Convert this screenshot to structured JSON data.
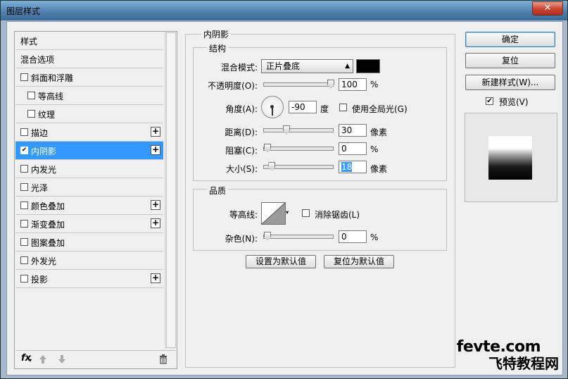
{
  "window": {
    "title": "图层样式",
    "close_glyph": "✕"
  },
  "styles_list": {
    "header": "样式",
    "blend_options": "混合选项",
    "items": [
      {
        "label": "斜面和浮雕",
        "checked": false,
        "has_plus": false
      },
      {
        "label": "等高线",
        "checked": false,
        "has_plus": false,
        "indent": true
      },
      {
        "label": "纹理",
        "checked": false,
        "has_plus": false,
        "indent": true
      },
      {
        "label": "描边",
        "checked": false,
        "has_plus": true
      },
      {
        "label": "内阴影",
        "checked": true,
        "has_plus": true,
        "selected": true
      },
      {
        "label": "内发光",
        "checked": false,
        "has_plus": false
      },
      {
        "label": "光泽",
        "checked": false,
        "has_plus": false
      },
      {
        "label": "颜色叠加",
        "checked": false,
        "has_plus": true
      },
      {
        "label": "渐变叠加",
        "checked": false,
        "has_plus": true
      },
      {
        "label": "图案叠加",
        "checked": false,
        "has_plus": false
      },
      {
        "label": "外发光",
        "checked": false,
        "has_plus": false
      },
      {
        "label": "投影",
        "checked": false,
        "has_plus": true
      }
    ],
    "footer": {
      "fx": "fx",
      "up_icon": "arrow-up-icon",
      "down_icon": "arrow-down-icon",
      "trash_icon": "trash-icon"
    }
  },
  "inner_shadow": {
    "section_title": "内阴影",
    "structure": {
      "title": "结构",
      "blend_mode_label": "混合模式:",
      "blend_mode_value": "正片叠底",
      "shadow_color": "#000000",
      "opacity_label": "不透明度(O):",
      "opacity_value": "100",
      "opacity_unit": "%",
      "angle_label": "角度(A):",
      "angle_value": "-90",
      "angle_unit": "度",
      "global_light_label": "使用全局光(G)",
      "global_light_checked": false,
      "distance_label": "距离(D):",
      "distance_value": "30",
      "distance_unit": "像素",
      "choke_label": "阻塞(C):",
      "choke_value": "0",
      "choke_unit": "%",
      "size_label": "大小(S):",
      "size_value": "18",
      "size_unit": "像素"
    },
    "quality": {
      "title": "品质",
      "contour_label": "等高线:",
      "anti_alias_label": "消除锯齿(L)",
      "anti_alias_checked": false,
      "noise_label": "杂色(N):",
      "noise_value": "0",
      "noise_unit": "%"
    },
    "make_default": "设置为默认值",
    "reset_default": "复位为默认值"
  },
  "buttons": {
    "ok": "确定",
    "reset": "复位",
    "new_style": "新建样式(W)...",
    "preview_label": "预览(V)",
    "preview_checked": true
  },
  "watermark": {
    "line1": "fevte.com",
    "line2": "飞特教程网"
  }
}
